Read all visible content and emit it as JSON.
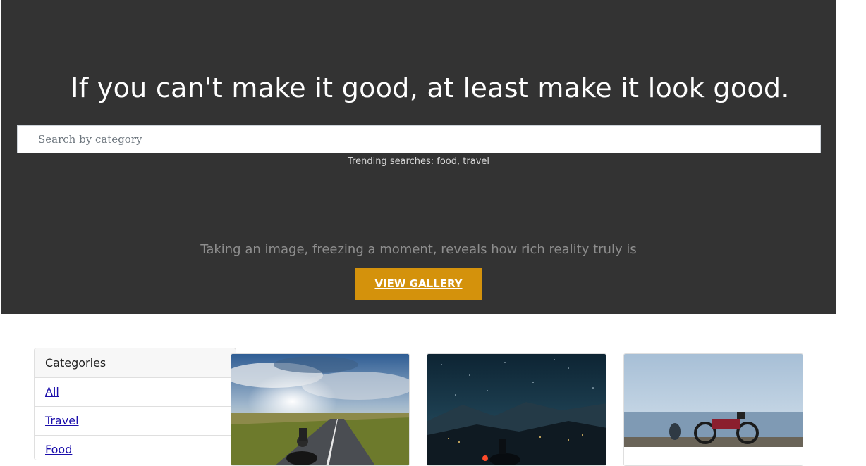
{
  "hero": {
    "title": "If you can't make it good, at least make it look good.",
    "search": {
      "placeholder": "Search by category",
      "value": ""
    },
    "trending": "Trending searches: food, travel",
    "tagline": "Taking an image, freezing a moment, reveals how rich reality truly is",
    "button_label": "VIEW GALLERY"
  },
  "categories": {
    "header": "Categories",
    "items": [
      {
        "label": "All"
      },
      {
        "label": "Travel"
      },
      {
        "label": "Food"
      }
    ]
  },
  "gallery": {
    "cards": [
      {
        "subject": "motorcycle-rider-on-road-at-sunset"
      },
      {
        "subject": "motorcycle-under-night-sky-mountains"
      },
      {
        "subject": "motorcycle-by-the-sea"
      }
    ]
  },
  "colors": {
    "hero_bg": "#333333",
    "button_bg": "#d4920c",
    "link": "#1a0dab"
  }
}
